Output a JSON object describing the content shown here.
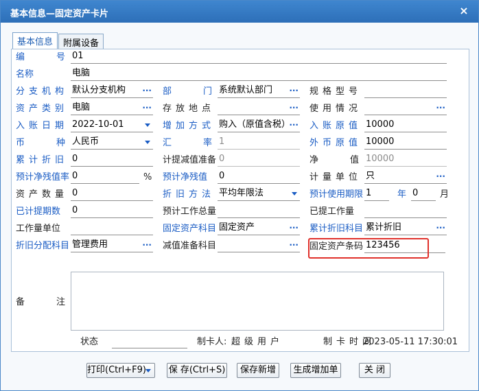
{
  "window": {
    "title": "基本信息—固定资产卡片",
    "close": "×"
  },
  "tabs": [
    {
      "label": "基本信息",
      "active": true
    },
    {
      "label": "附属设备",
      "active": false
    }
  ],
  "form": {
    "code_label": "编号",
    "code": "01",
    "name_label": "名称",
    "name": "电脑",
    "branch_label": "分支机构",
    "branch": "默认分支机构",
    "dept_label": "部门",
    "dept": "系统默认部门",
    "model_label": "规格型号",
    "model": "",
    "asset_type_label": "资产类别",
    "asset_type": "电脑",
    "location_label": "存放地点",
    "location": "",
    "usage_label": "使用情况",
    "usage": "",
    "entry_date_label": "入账日期",
    "entry_date": "2022-10-01",
    "add_method_label": "增加方式",
    "add_method": "购入（原值含税）",
    "entry_value_label": "入账原值",
    "entry_value": "10000",
    "currency_label": "币种",
    "currency": "人民币",
    "rate_label": "汇率",
    "rate": "1",
    "foreign_value_label": "外币原值",
    "foreign_value": "10000",
    "accum_dep_label": "累计折旧",
    "accum_dep": "0",
    "impairment_label": "计提减值准备",
    "impairment": "0",
    "net_label": "净值",
    "net": "10000",
    "residual_rate_label": "预计净残值率",
    "residual_rate": "0",
    "percent": "%",
    "residual_value_label": "预计净残值",
    "residual_value": "0",
    "unit_label": "计量单位",
    "unit": "只",
    "quantity_label": "资产数量",
    "quantity": "0",
    "dep_method_label": "折旧方法",
    "dep_method": "平均年限法",
    "life_label": "预计使用期限",
    "life_years": "1",
    "year_unit": "年",
    "life_months": "0",
    "month_unit": "月",
    "periods_label": "已计提期数",
    "periods": "0",
    "total_work_label": "预计工作总量",
    "total_work": "",
    "done_work_label": "已提工作量",
    "done_work": "",
    "work_unit_label": "工作量单位",
    "work_unit": "",
    "asset_subject_label": "固定资产科目",
    "asset_subject": "固定资产",
    "dep_subject_label": "累计折旧科目",
    "dep_subject": "累计折旧",
    "alloc_subject_label": "折旧分配科目",
    "alloc_subject": "管理费用",
    "impair_subject_label": "减值准备科目",
    "impair_subject": "",
    "barcode_label": "固定资产条码",
    "barcode": "123456",
    "remark_label": "备注",
    "remark": "",
    "status_label": "状态",
    "status": "",
    "maker_label": "制卡人:",
    "maker": "超级用户",
    "time_label": "制卡时间",
    "time": "2023-05-11 17:30:01"
  },
  "buttons": {
    "print": "打印(Ctrl+F9)",
    "save": "保 存(Ctrl+S)",
    "save_new": "保存新增",
    "gen_add": "生成增加单",
    "close": "关 闭"
  },
  "colors": {
    "title_bar": "#3f86cf",
    "label_blue": "#1a5cc4",
    "highlight": "#e0302a"
  }
}
